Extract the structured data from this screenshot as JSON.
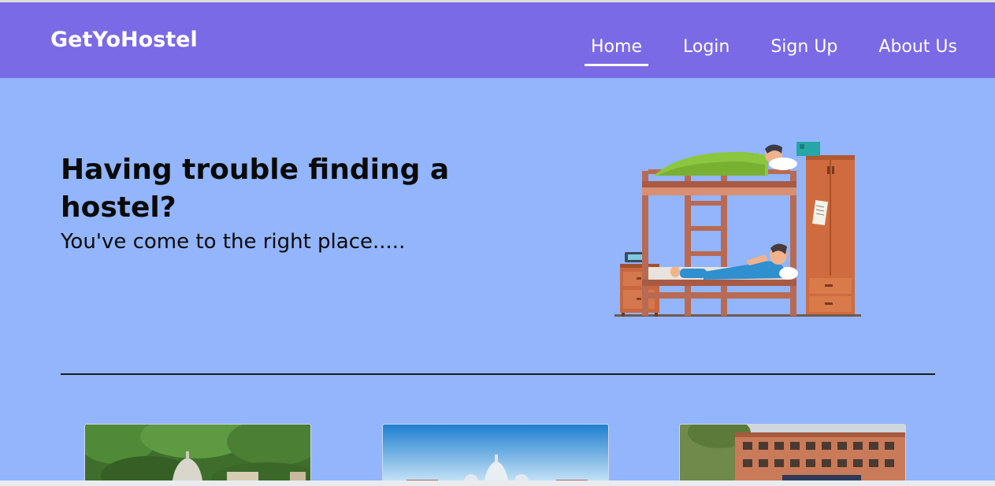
{
  "app": {
    "brand": "GetYoHostel"
  },
  "nav": {
    "items": [
      {
        "label": "Home",
        "active": true
      },
      {
        "label": "Login",
        "active": false
      },
      {
        "label": "Sign Up",
        "active": false
      },
      {
        "label": "About Us",
        "active": false
      }
    ]
  },
  "hero": {
    "title": "Having trouble finding a hostel?",
    "subtitle": "You've come to the right place.....",
    "illustration": "bunk-bed-students-illustration"
  },
  "cards": [
    {
      "image": "hill-campus-dome-photo"
    },
    {
      "image": "sky-domed-building-photo"
    },
    {
      "image": "college-building-photo"
    }
  ],
  "colors": {
    "navbar": "#7a6ae6",
    "background": "#92b5fb",
    "text": "#0a0a0a"
  }
}
